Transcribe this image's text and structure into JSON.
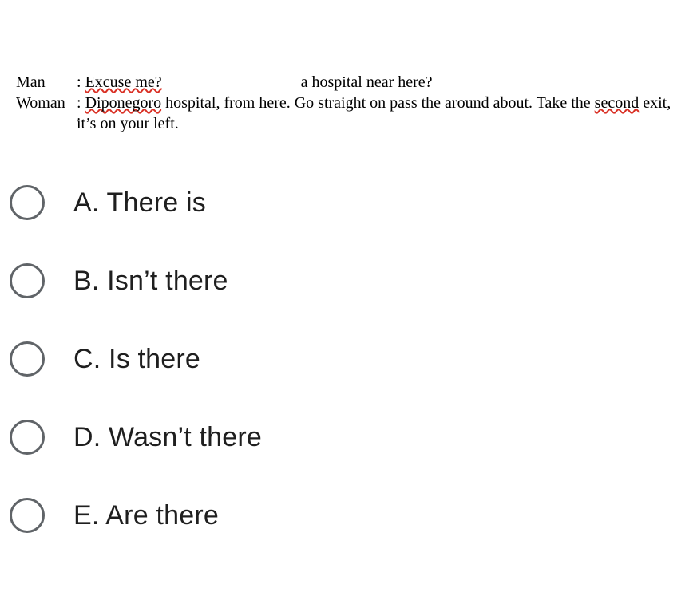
{
  "dialogue": {
    "man_speaker": "Man",
    "man_pre": "Excuse me?",
    "man_post": "a hospital near here?",
    "woman_speaker": "Woman",
    "woman_word1": "Diponegoro",
    "woman_seg1": " hospital, from here. Go straight on pass the around about. Take the ",
    "woman_word2": "second",
    "woman_seg2": " exit, it’s on your left."
  },
  "options": {
    "a": "A. There is",
    "b": "B. Isn’t there",
    "c": "C. Is there",
    "d": "D. Wasn’t there",
    "e": "E. Are there"
  }
}
